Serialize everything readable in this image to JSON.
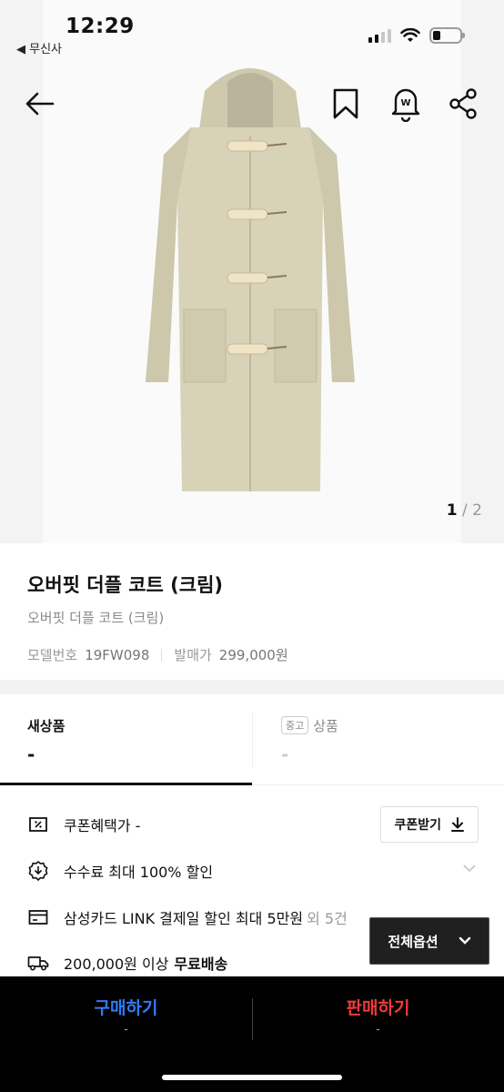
{
  "status_bar": {
    "time": "12:29",
    "back_app": "◀ 무신사"
  },
  "hero": {
    "pager_current": "1",
    "pager_total": "/ 2"
  },
  "product": {
    "title": "오버핏 더플 코트 (크림)",
    "subtitle": "오버핏 더플 코트 (크림)",
    "model_label": "모델번호",
    "model_value": "19FW098",
    "release_label": "발매가",
    "release_value": "299,000원"
  },
  "tabs": {
    "new_label": "새상품",
    "new_price": "-",
    "used_badge": "중고",
    "used_label": "상품",
    "used_price": "-"
  },
  "benefits": {
    "coupon_text": "쿠폰혜택가 -",
    "coupon_button": "쿠폰받기",
    "fee_text": "수수료 최대 100% 할인",
    "card_text": "삼성카드 LINK 결제일 할인 최대 5만원",
    "card_more": "외 5건",
    "shipping_text": "200,000원 이상",
    "shipping_bold": "무료배송"
  },
  "options_button": "전체옵션",
  "bottom_bar": {
    "buy_label": "구매하기",
    "buy_sub": "-",
    "sell_label": "판매하기",
    "sell_sub": "-"
  },
  "colors": {
    "buy": "#2f7cf6",
    "sell": "#f03a3a",
    "coat": "#d8d3b8"
  },
  "icons": [
    "back-arrow-icon",
    "bookmark-icon",
    "bell-icon",
    "share-icon",
    "coupon-icon",
    "discount-icon",
    "card-icon",
    "truck-icon",
    "download-icon",
    "chevron-down-icon"
  ]
}
